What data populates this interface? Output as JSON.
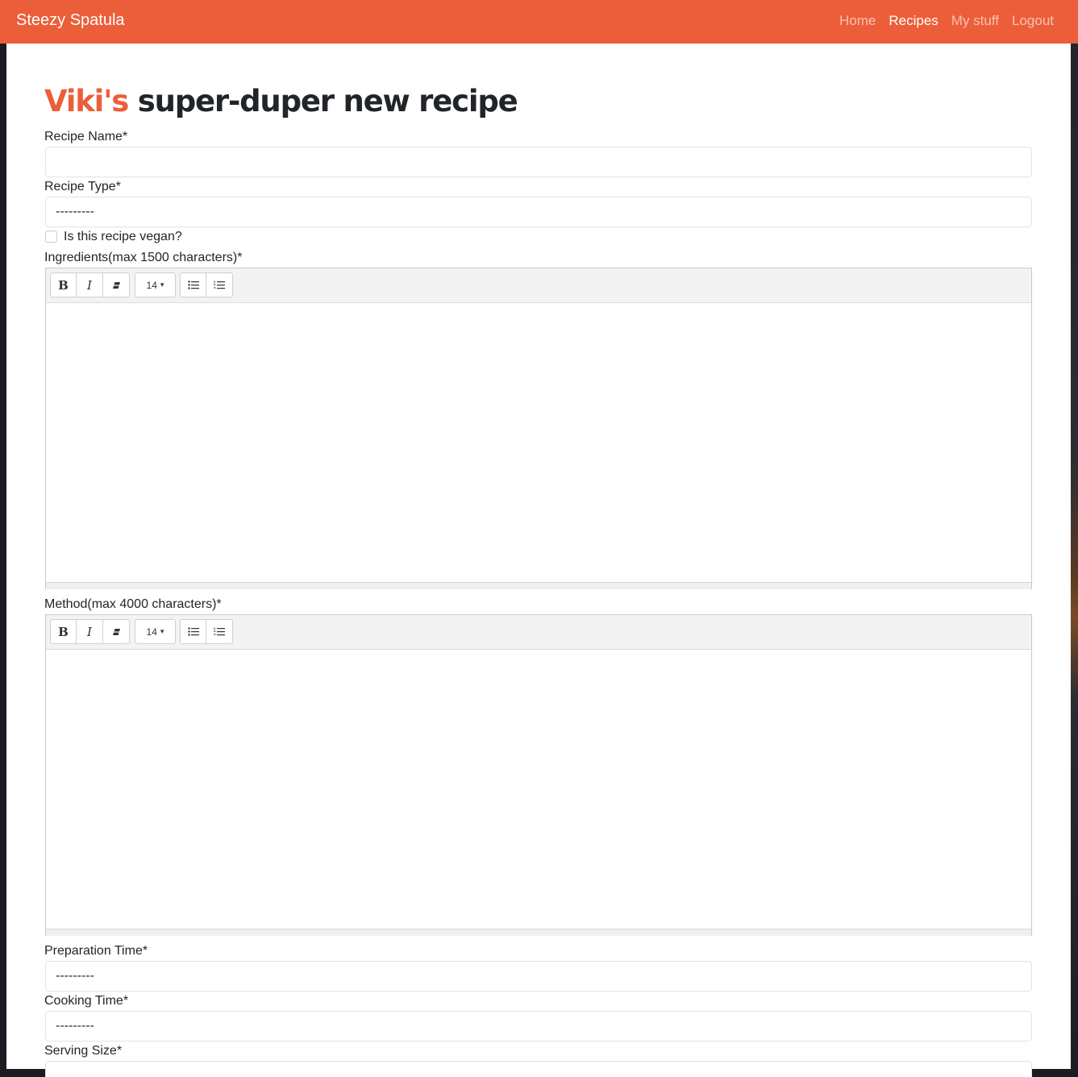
{
  "navbar": {
    "brand": "Steezy Spatula",
    "links": [
      {
        "label": "Home"
      },
      {
        "label": "Recipes"
      },
      {
        "label": "My stuff"
      },
      {
        "label": "Logout"
      }
    ]
  },
  "page": {
    "heading_name": "Viki's",
    "heading_rest": " super-duper new recipe"
  },
  "form": {
    "recipe_name_label": "Recipe Name*",
    "recipe_name_value": "",
    "recipe_type_label": "Recipe Type*",
    "recipe_type_value": "---------",
    "vegan_label": "Is this recipe vegan?",
    "vegan_checked": false,
    "ingredients_label": "Ingredients(max 1500 characters)*",
    "method_label": "Method(max 4000 characters)*",
    "prep_time_label": "Preparation Time*",
    "prep_time_value": "---------",
    "cook_time_label": "Cooking Time*",
    "cook_time_value": "---------",
    "serving_size_label": "Serving Size*"
  },
  "editor_toolbar": {
    "bold": "B",
    "italic": "I",
    "font_size": "14",
    "dropdown_caret": "▾",
    "eraser_icon": "eraser-icon",
    "unordered_list_icon": "unordered-list-icon",
    "ordered_list_icon": "ordered-list-icon"
  },
  "colors": {
    "accent": "#ec5e39",
    "text": "#212529"
  }
}
